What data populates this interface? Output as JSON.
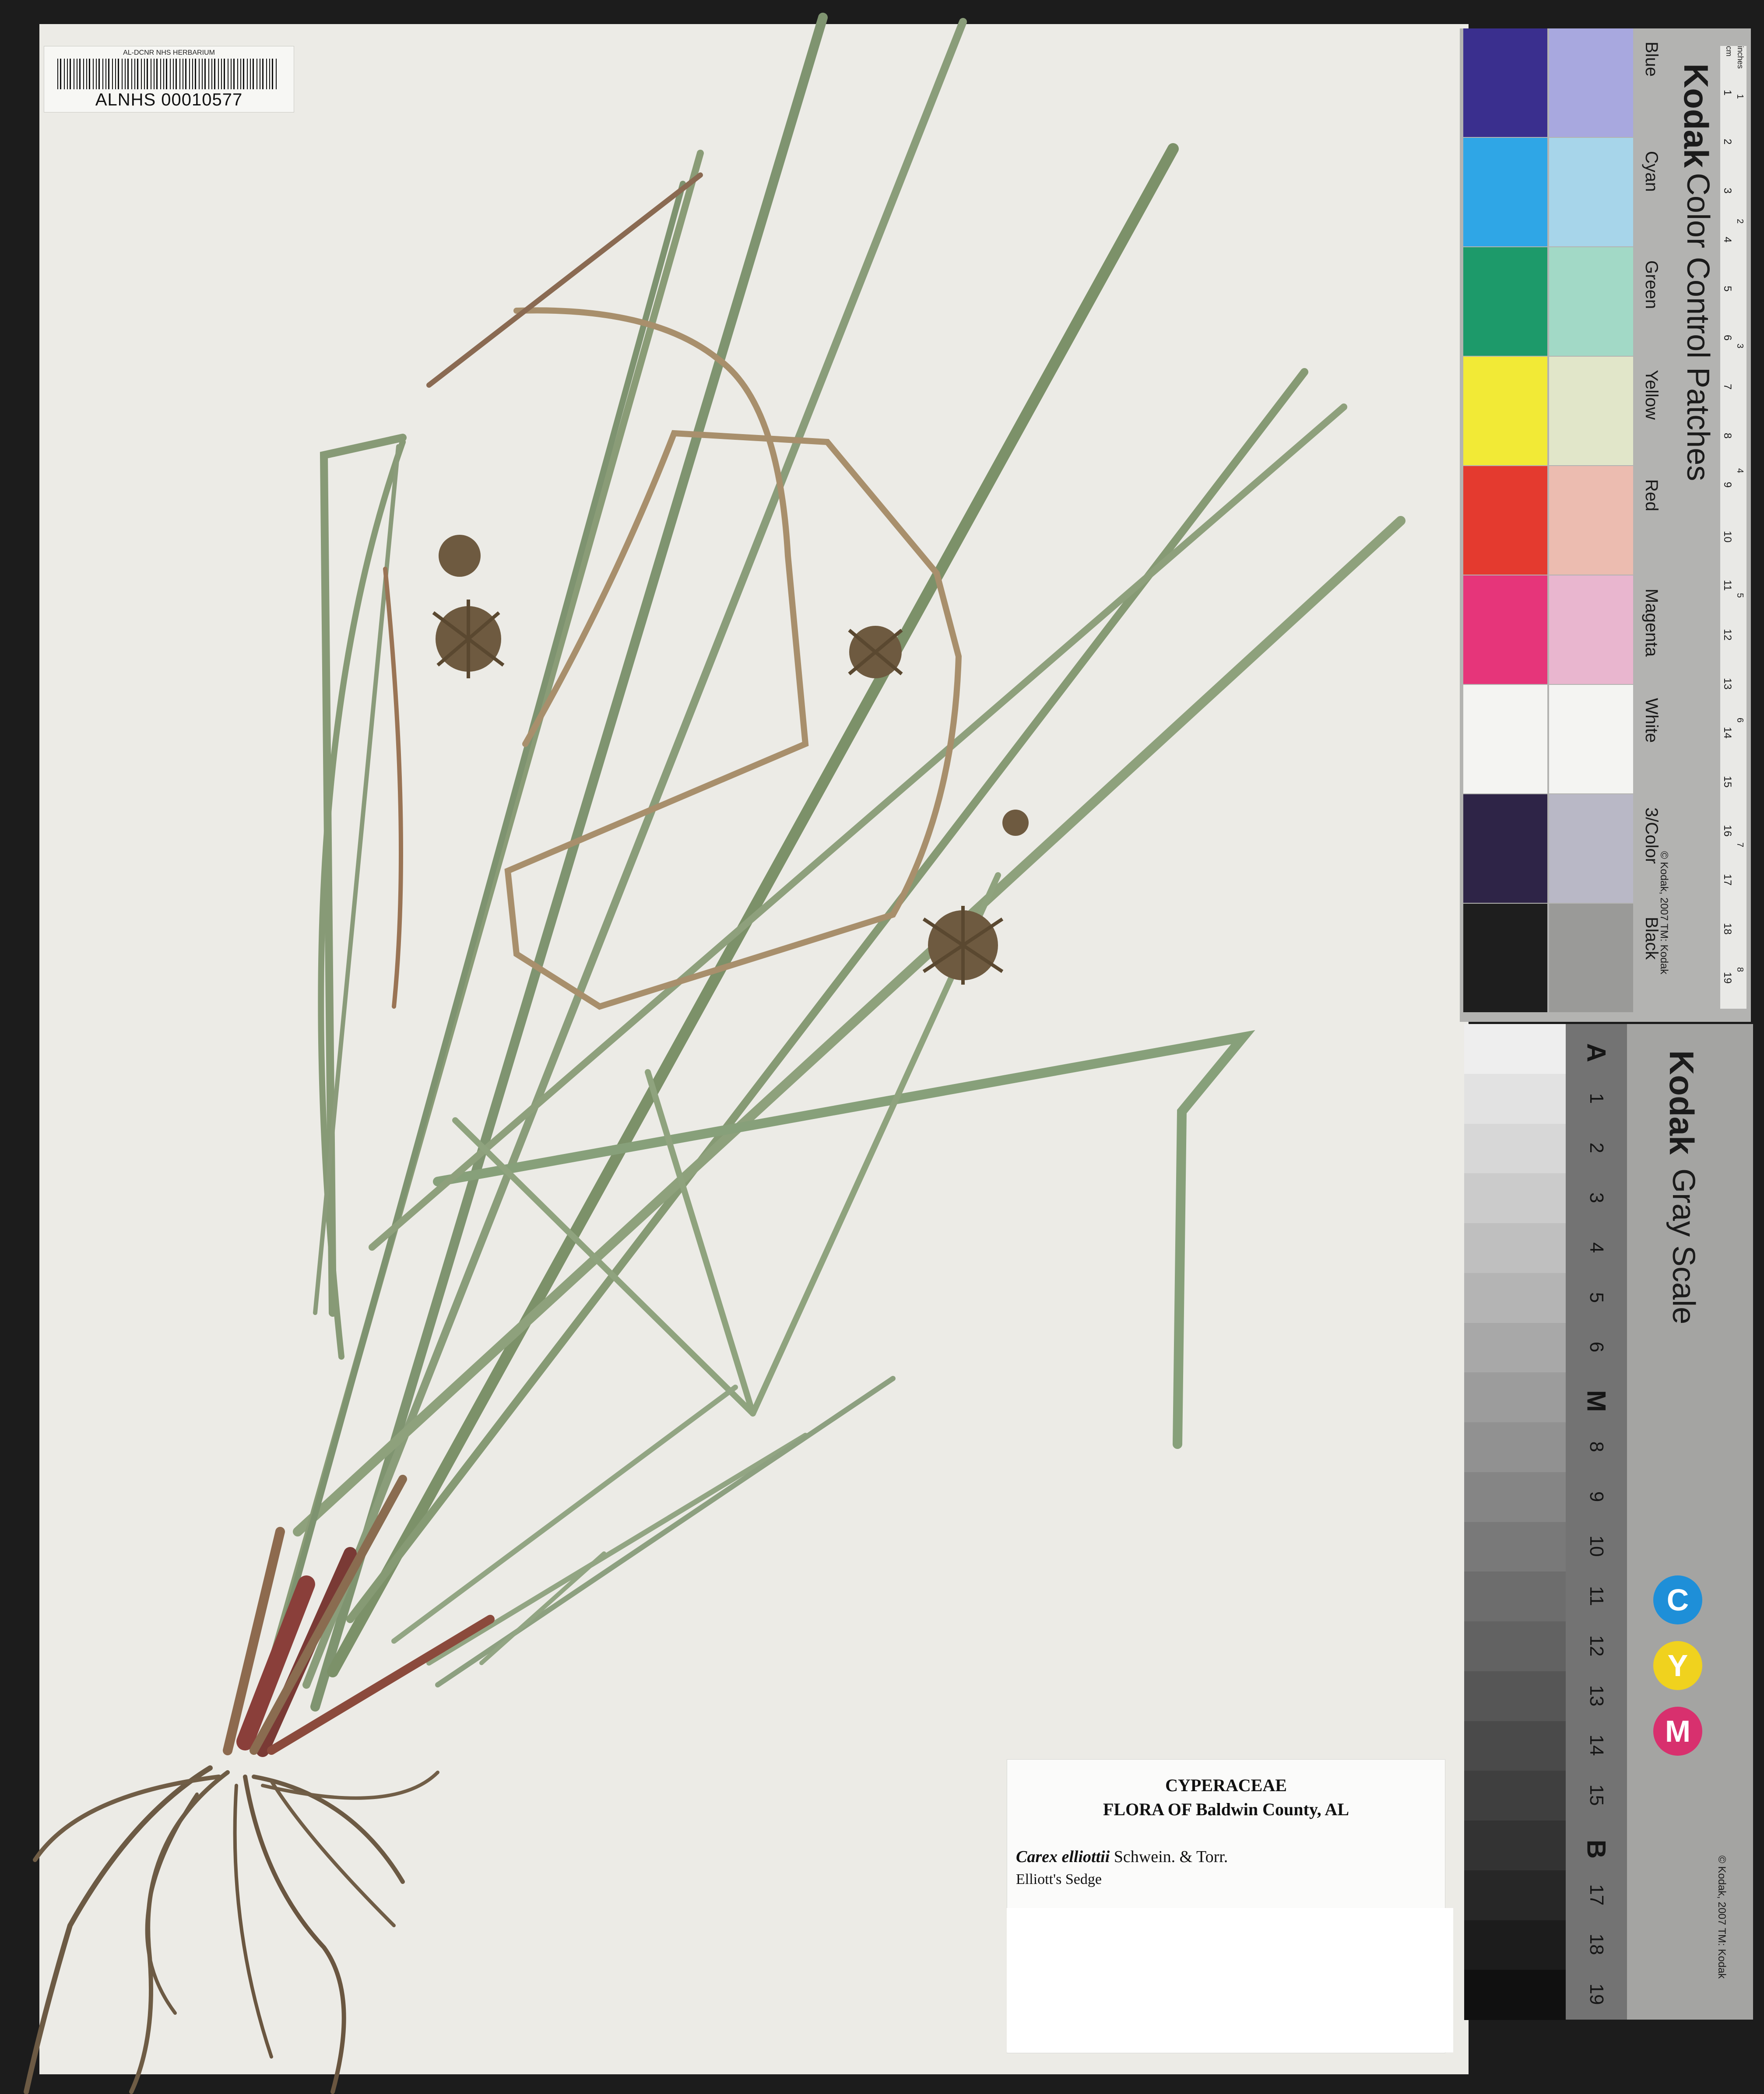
{
  "barcode": {
    "caption": "AL-DCNR NHS HERBARIUM",
    "number": "ALNHS 00010577"
  },
  "specimen_label": {
    "family": "CYPERACEAE",
    "flora": "FLORA OF Baldwin County, AL",
    "scientific_name": "Carex elliottii",
    "authority": "Schwein. & Torr.",
    "common_name": "Elliott's Sedge"
  },
  "color_card": {
    "brand": "Kodak",
    "title": "Color Control Patches",
    "copyright": "© Kodak, 2007 TM: Kodak",
    "patch_names": [
      "Blue",
      "Cyan",
      "Green",
      "Yellow",
      "Red",
      "Magenta",
      "White",
      "3/Color",
      "Black"
    ],
    "patch_colors": [
      [
        "#3a2f8e",
        "#a8a8df"
      ],
      [
        "#2fa6e6",
        "#a7d5ea"
      ],
      [
        "#1d9a6a",
        "#a2d9c6"
      ],
      [
        "#f2ea36",
        "#e1e6c9"
      ],
      [
        "#e43a2f",
        "#ecbcb0"
      ],
      [
        "#e6357a",
        "#e9b6cf"
      ],
      [
        "#f4f4f2",
        "#f4f4f2"
      ],
      [
        "#2e2447",
        "#b9b8c6"
      ],
      [
        "#1e1e1e",
        "#9a9a98"
      ]
    ],
    "ruler_units_top": "inches",
    "ruler_units_cm": "cm",
    "ruler_cm_numbers": [
      "1",
      "2",
      "3",
      "4",
      "5",
      "6",
      "7",
      "8",
      "9",
      "10",
      "11",
      "12",
      "13",
      "14",
      "15",
      "16",
      "17",
      "18",
      "19"
    ],
    "ruler_inch_numbers": [
      "1",
      "2",
      "3",
      "4",
      "5",
      "6",
      "7",
      "8"
    ]
  },
  "gray_card": {
    "brand": "Kodak",
    "title": "Gray Scale",
    "copyright": "© Kodak, 2007 TM: Kodak",
    "step_labels": [
      "A",
      "1",
      "2",
      "3",
      "4",
      "5",
      "6",
      "M",
      "8",
      "9",
      "10",
      "11",
      "12",
      "13",
      "14",
      "15",
      "B",
      "17",
      "18",
      "19"
    ],
    "cmy": [
      "C",
      "Y",
      "M"
    ],
    "cmy_colors": [
      "#1e8fd8",
      "#f0d21e",
      "#d8306e"
    ]
  }
}
